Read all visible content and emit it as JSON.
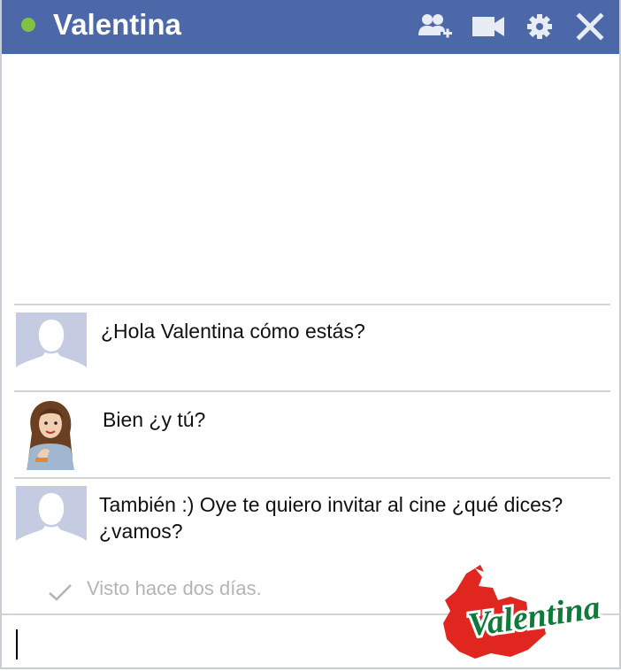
{
  "window": {
    "title": "Valentina",
    "status": "online",
    "status_color": "#7fc241",
    "header_color": "#4c68a8",
    "toolbar_icons": [
      "add-friend-icon",
      "video-call-icon",
      "settings-icon",
      "close-icon"
    ]
  },
  "messages": [
    {
      "sender": "friend-default-avatar",
      "text": "¿Hola Valentina cómo estás?"
    },
    {
      "sender": "valentina-avatar",
      "text": "Bien ¿y tú?"
    },
    {
      "sender": "friend-default-avatar",
      "text_line1": "También :) Oye te quiero invitar al cine ¿qué dices?",
      "text_line2": "¿vamos?"
    }
  ],
  "seen": {
    "icon": "check-icon",
    "text": "Visto hace dos días."
  },
  "composer": {
    "value": ""
  },
  "logo": {
    "text": "Valentina",
    "color_red": "#e0261e",
    "color_green": "#0f7a3a"
  }
}
